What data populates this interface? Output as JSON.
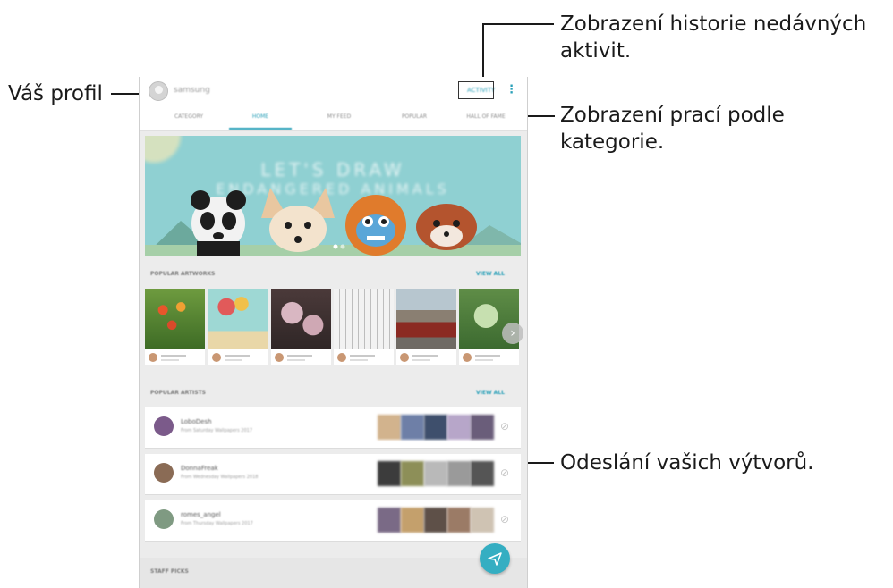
{
  "callouts": {
    "history": [
      "Zobrazení historie nedávných",
      "aktivit."
    ],
    "profile": "Váš profil",
    "categories": "Zobrazení prací podle kategorie.",
    "upload": "Odeslání vašich výtvorů."
  },
  "app": {
    "username": "samsung",
    "activity": "ACTIVITY",
    "tabs": [
      "CATEGORY",
      "HOME",
      "MY FEED",
      "POPULAR",
      "HALL OF FAME"
    ],
    "active_tab": "HOME",
    "banner_text": [
      "LET'S DRAW",
      "ENDANGERED ANIMALS"
    ],
    "popular_artworks": "POPULAR ARTWORKS",
    "view_all": "VIEW ALL",
    "popular_artists": "POPULAR ARTISTS",
    "artists": [
      {
        "name": "LoboDesh",
        "sub": "From Saturday Wallpapers 2017"
      },
      {
        "name": "DonnaFreak",
        "sub": "From Wednesday Wallpapers 2018"
      },
      {
        "name": "romes_angel",
        "sub": "From Thursday Wallpapers 2017"
      }
    ],
    "staff_picks": "STAFF PICKS"
  },
  "colors": {
    "accent": "#2aa0b8",
    "fab": "#35aec2",
    "banner_sky": "#8fd0d2"
  },
  "icons": [
    "avatar",
    "more-vert-icon",
    "send-icon",
    "chevron-right-icon",
    "follow-icon"
  ]
}
